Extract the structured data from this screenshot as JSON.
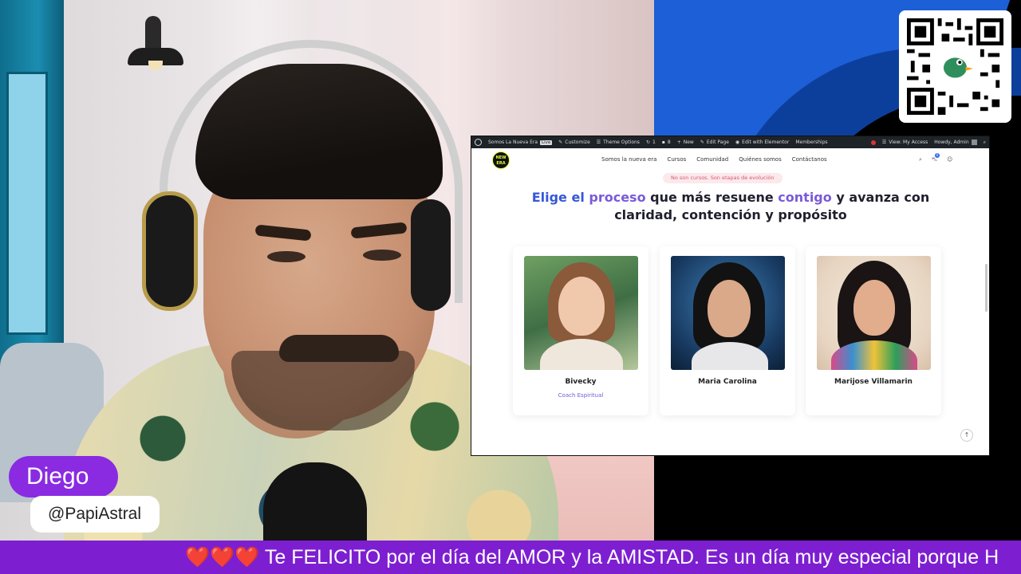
{
  "overlay": {
    "name_tag": "Diego",
    "handle": "@PapiAstral",
    "ticker_hearts": "❤️❤️❤️",
    "ticker_text": "Te FELICITO por el día del AMOR y la AMISTAD. Es un día muy especial porque H"
  },
  "wp_admin_bar": {
    "site_name": "Somos La Nueva Era",
    "live_badge": "Live",
    "customize": "Customize",
    "theme_options": "Theme Options",
    "updates_count": "1",
    "comments_count": "8",
    "new": "New",
    "edit_page": "Edit Page",
    "edit_elementor": "Edit with Elementor",
    "memberships": "Memberships",
    "view_access": "View: My Access",
    "howdy": "Howdy, Admin"
  },
  "site": {
    "logo_text": "NEW ERA",
    "nav": [
      "Somos la nueva era",
      "Cursos",
      "Comunidad",
      "Quiénes somos",
      "Contáctanos"
    ],
    "cart_count": "0",
    "pill": "No son cursos. Son etapas de evolución",
    "hero": {
      "w1": "Elige el",
      "w2": "proceso",
      "w3": "que más resuene",
      "w4": "contigo",
      "w5": "y avanza con claridad, contención y propósito"
    },
    "coaches": [
      {
        "name": "Bivecky",
        "role": "Coach Espiritual"
      },
      {
        "name": "Maria Carolina",
        "role": ""
      },
      {
        "name": "Marijose Villamarin",
        "role": ""
      }
    ]
  },
  "colors": {
    "ticker_bg": "#7d1fd1",
    "name_tag_bg": "#8a2be2",
    "hero_blue": "#3657d6",
    "hero_purple": "#7a5ad8"
  }
}
